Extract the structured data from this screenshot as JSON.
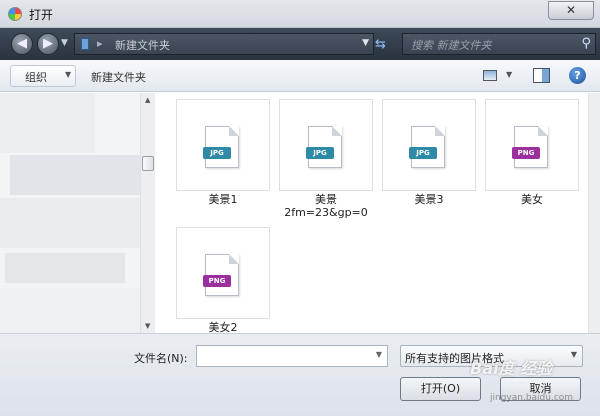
{
  "window": {
    "title": "打开",
    "close_glyph": "✕"
  },
  "nav": {
    "back_glyph": "◀",
    "forward_glyph": "▶",
    "address_path": "新建文件夹",
    "search_placeholder": "搜索 新建文件夹"
  },
  "toolbar": {
    "organize_label": "组织",
    "new_folder_label": "新建文件夹",
    "help_glyph": "?"
  },
  "files": [
    {
      "name": "美景1",
      "type": "JPG",
      "badge_color": "#2e8aa6"
    },
    {
      "name": "美景\n2fm=23&gp=0",
      "type": "JPG",
      "badge_color": "#2e8aa6"
    },
    {
      "name": "美景3",
      "type": "JPG",
      "badge_color": "#2e8aa6"
    },
    {
      "name": "美女",
      "type": "PNG",
      "badge_color": "#9b2f9e"
    },
    {
      "name": "美女2",
      "type": "PNG",
      "badge_color": "#9b2f9e"
    }
  ],
  "bottom": {
    "filename_label": "文件名(N):",
    "filename_value": "",
    "filetype_value": "所有支持的图片格式",
    "open_label": "打开(O)",
    "cancel_label": "取消"
  },
  "watermark": {
    "text": "Bai度 经验",
    "sub": "jingyan.baidu.com"
  }
}
